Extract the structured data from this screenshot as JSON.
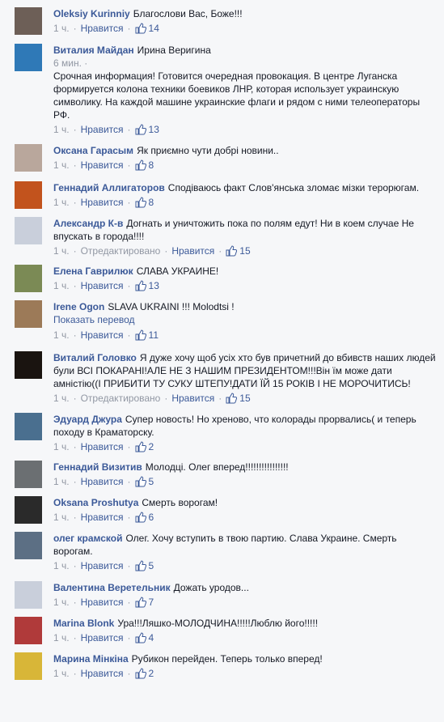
{
  "comments": [
    {
      "author": "Oleksiy Kurinniy",
      "text": "Благослови Вас, Боже!!!",
      "time": "1 ч.",
      "like_label": "Нравится",
      "likes": "14",
      "avatar_color": "#6d5f57"
    },
    {
      "author": "Виталия Майдан",
      "text": "Ирина Веригина",
      "sub": "6 мин. ·",
      "body": "Срочная информация! Готовится очередная провокация. В центре Луганска формируется колона техники боевиков ЛНР, которая использует украинскую символику. На каждой машине украинские флаги и рядом с ними телеоператоры РФ.",
      "time": "1 ч.",
      "like_label": "Нравится",
      "likes": "13",
      "avatar_color": "#2f79b7"
    },
    {
      "author": "Оксана Гарасым",
      "text": "Як приємно чути добрі новини..",
      "time": "1 ч.",
      "like_label": "Нравится",
      "likes": "8",
      "avatar_color": "#b9a79c"
    },
    {
      "author": "Геннадий Аллигаторов",
      "text": "Сподіваюсь факт Слов'янська зломає мізки терорюгам.",
      "time": "1 ч.",
      "like_label": "Нравится",
      "likes": "8",
      "avatar_color": "#c2531d"
    },
    {
      "author": "Александр К-в",
      "text": "Догнать и уничтожить пока по полям едут! Ни в коем случае Не впускать в города!!!!",
      "time": "1 ч.",
      "edited": "Отредактировано",
      "like_label": "Нравится",
      "likes": "15",
      "avatar_color": "#c9cfdb"
    },
    {
      "author": "Елена Гаврилюк",
      "text": "СЛАВА УКРАИНЕ!",
      "time": "1 ч.",
      "like_label": "Нравится",
      "likes": "13",
      "avatar_color": "#7b8a55"
    },
    {
      "author": "Irene Ogon",
      "text": "SLAVA UKRAINI !!! Molodtsi !",
      "translate": "Показать перевод",
      "time": "1 ч.",
      "like_label": "Нравится",
      "likes": "11",
      "avatar_color": "#9c7a58"
    },
    {
      "author": "Виталий Головко",
      "text": "Я дуже хочу щоб усіх хто був причетний до вбивств наших людей були ВСІ ПОКАРАНІ!АЛЕ НЕ З НАШИМ ПРЕЗИДЕНТОМ!!!Він їм може дати амністію((І ПРИБИТИ ТУ СУКУ ШТЕПУ!ДАТИ ЇЙ 15 РОКІВ І НЕ МОРОЧИТИСЬ!",
      "time": "1 ч.",
      "edited": "Отредактировано",
      "like_label": "Нравится",
      "likes": "15",
      "avatar_color": "#1a1410"
    },
    {
      "author": "Эдуард Джура",
      "text": "Супер новость! Но хреново, что колорады прорвались( и теперь походу в Краматорску.",
      "time": "1 ч.",
      "like_label": "Нравится",
      "likes": "2",
      "avatar_color": "#4a6f8f"
    },
    {
      "author": "Геннадий Визитив",
      "text": "Молодці. Олег вперед!!!!!!!!!!!!!!!!",
      "time": "1 ч.",
      "like_label": "Нравится",
      "likes": "5",
      "avatar_color": "#6b6f72"
    },
    {
      "author": "Oksana Proshutya",
      "text": "Смерть ворогам!",
      "time": "1 ч.",
      "like_label": "Нравится",
      "likes": "6",
      "avatar_color": "#2a2a2a"
    },
    {
      "author": "олег крамской",
      "text": "Олег. Хочу вступить в твою партию. Слава Украине. Смерть ворогам.",
      "time": "1 ч.",
      "like_label": "Нравится",
      "likes": "5",
      "avatar_color": "#5c6f84"
    },
    {
      "author": "Валентина Веретельник",
      "text": "Дожать уродов...",
      "time": "1 ч.",
      "like_label": "Нравится",
      "likes": "7",
      "avatar_color": "#c9cfdb"
    },
    {
      "author": "Marina Blonk",
      "text": "Ура!!!Ляшко-МОЛОДЧИНА!!!!!Люблю його!!!!!",
      "time": "1 ч.",
      "like_label": "Нравится",
      "likes": "4",
      "avatar_color": "#b03a3a"
    },
    {
      "author": "Марина Мінкіна",
      "text": "Рубикон перейден. Теперь только вперед!",
      "time": "1 ч.",
      "like_label": "Нравится",
      "likes": "2",
      "avatar_color": "#d8b638"
    }
  ]
}
